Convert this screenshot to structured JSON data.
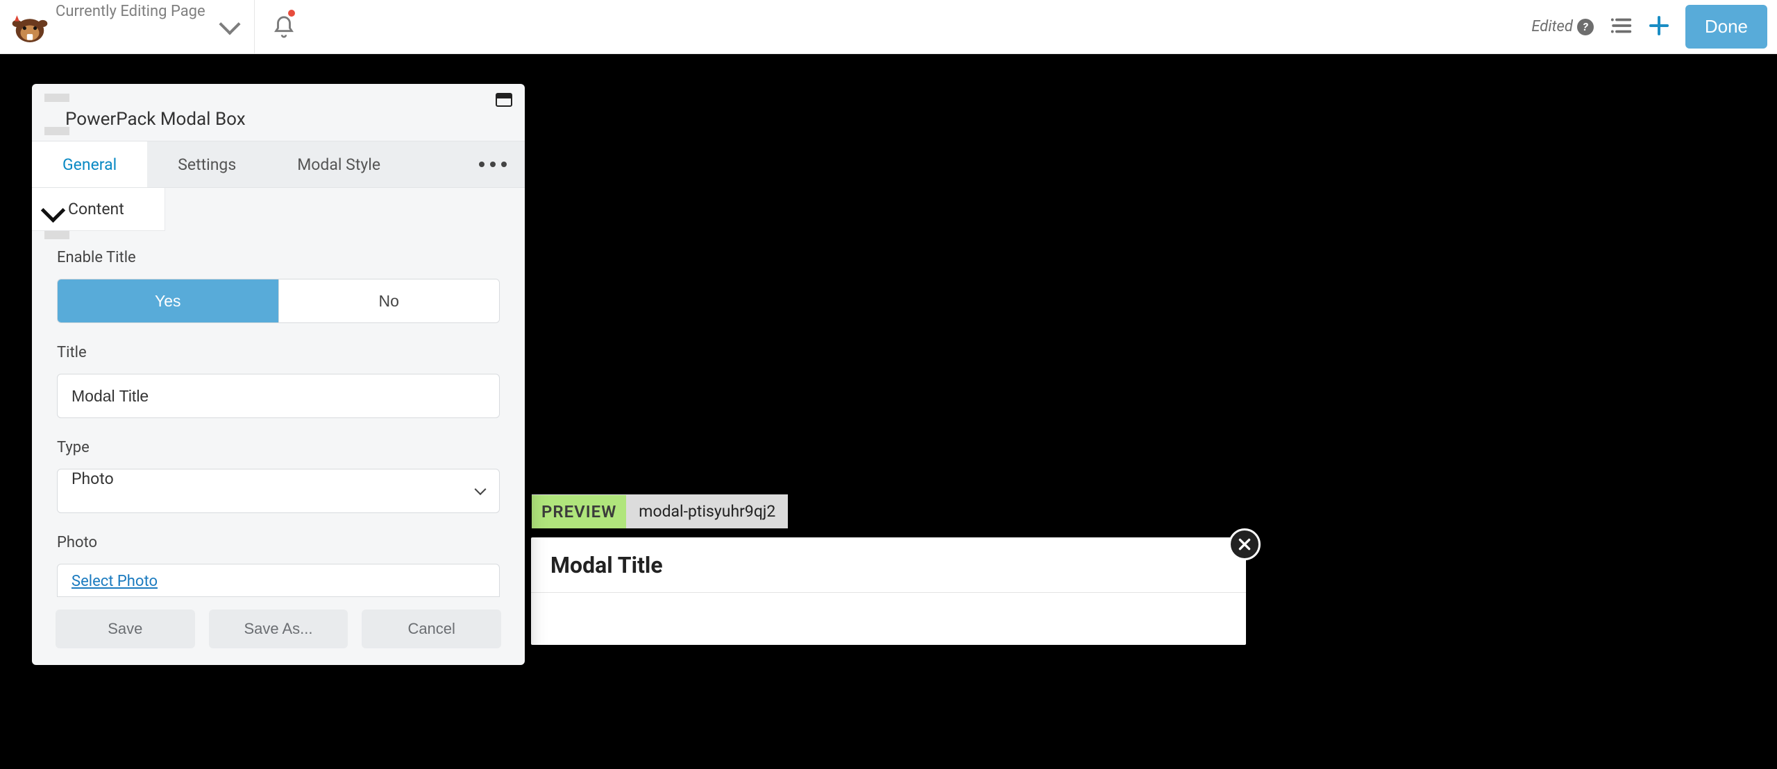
{
  "topbar": {
    "page_label": "Currently Editing Page",
    "edited_label": "Edited",
    "done_label": "Done"
  },
  "panel": {
    "title": "PowerPack Modal Box",
    "tabs": [
      "General",
      "Settings",
      "Modal Style"
    ],
    "active_tab_index": 0,
    "section_label": "Content",
    "fields": {
      "enable_title": {
        "label": "Enable Title",
        "options": [
          "Yes",
          "No"
        ],
        "selected_index": 0
      },
      "title": {
        "label": "Title",
        "value": "Modal Title"
      },
      "type": {
        "label": "Type",
        "value": "Photo"
      },
      "photo": {
        "label": "Photo",
        "link_text": "Select Photo"
      }
    },
    "actions": {
      "save": "Save",
      "save_as": "Save As...",
      "cancel": "Cancel"
    }
  },
  "preview": {
    "badge": "PREVIEW",
    "id": "modal-ptisyuhr9qj2",
    "modal_title": "Modal Title"
  }
}
